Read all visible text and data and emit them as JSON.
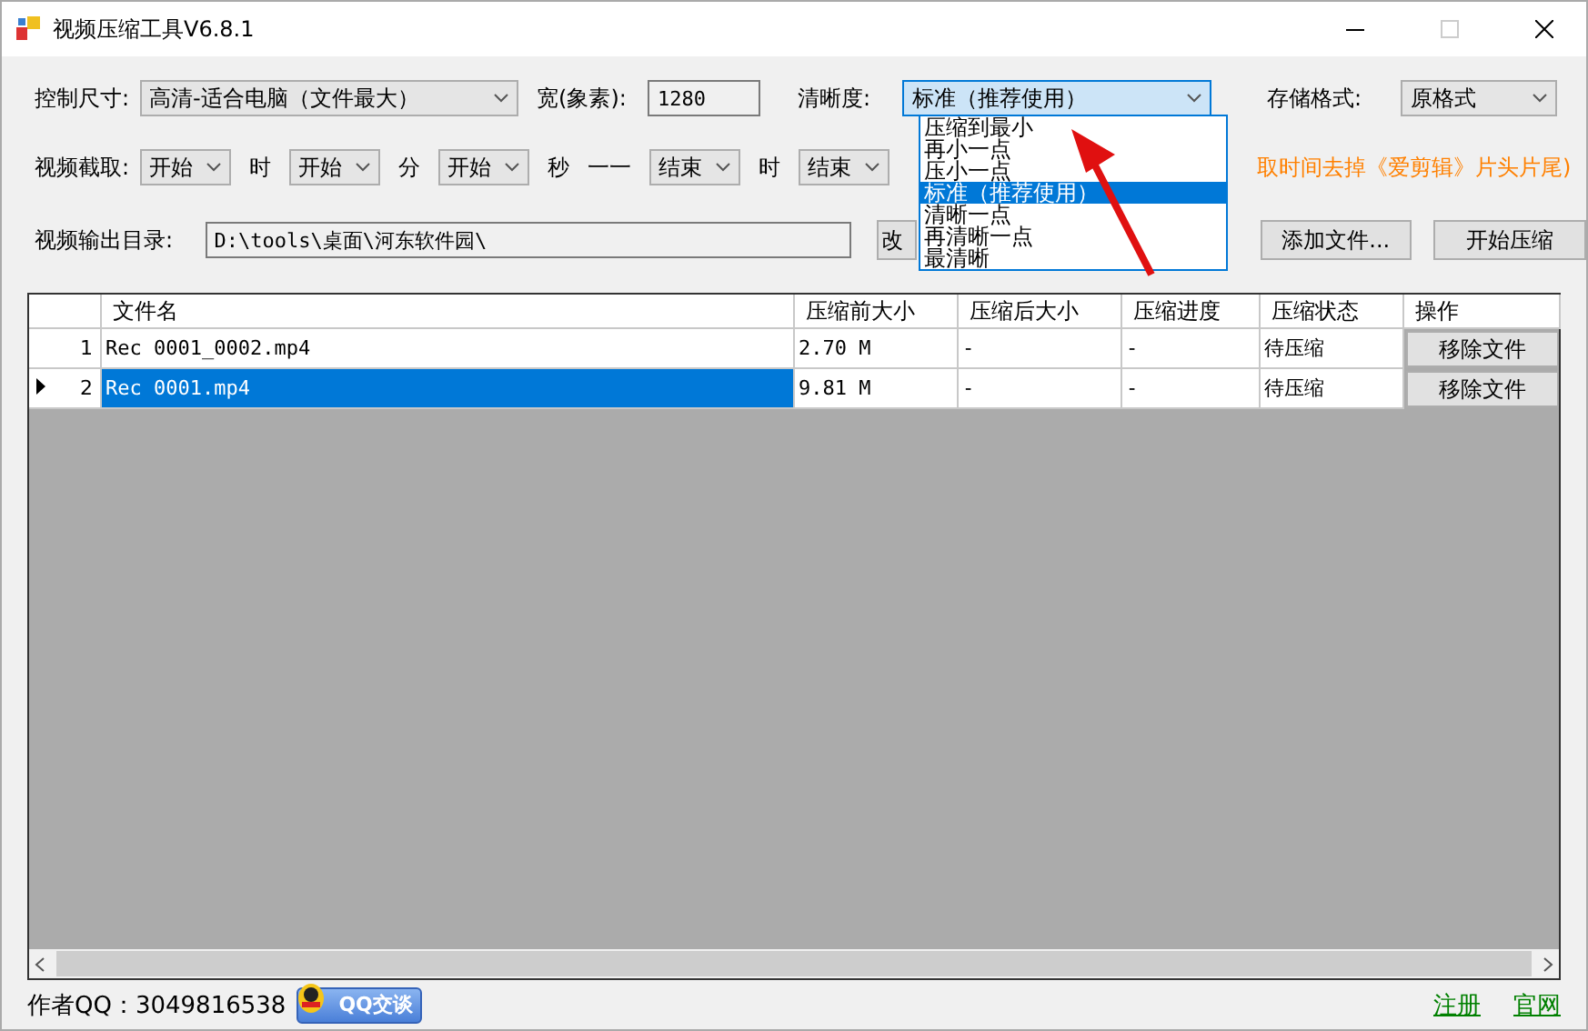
{
  "window": {
    "title": "视频压缩工具V6.8.1"
  },
  "size_row": {
    "label": "控制尺寸:",
    "size_value": "高清-适合电脑（文件最大）",
    "width_label": "宽(象素):",
    "width_value": "1280",
    "clarity_label": "清晰度:",
    "clarity_value": "标准（推荐使用）",
    "format_label": "存储格式:",
    "format_value": "原格式"
  },
  "clarity_dropdown": {
    "options": [
      {
        "label": "压缩到最小",
        "selected": false
      },
      {
        "label": "再小一点",
        "selected": false
      },
      {
        "label": "压小一点",
        "selected": false
      },
      {
        "label": "标准（推荐使用）",
        "selected": true
      },
      {
        "label": "清晰一点",
        "selected": false
      },
      {
        "label": "再清晰一点",
        "selected": false
      },
      {
        "label": "最清晰",
        "selected": false
      }
    ]
  },
  "trim_row": {
    "label": "视频截取:",
    "start_fields": [
      {
        "value": "开始",
        "unit": "时"
      },
      {
        "value": "开始",
        "unit": "分"
      },
      {
        "value": "开始",
        "unit": "秒"
      }
    ],
    "separator": "一一",
    "end_fields": [
      {
        "value": "结束",
        "unit": "时"
      },
      {
        "value": "结束"
      }
    ],
    "hint": "取时间去掉《爱剪辑》片头片尾)"
  },
  "output_row": {
    "label": "视频输出目录:",
    "path": "D:\\tools\\桌面\\河东软件园\\",
    "change_button": "改",
    "add_button": "添加文件...",
    "start_button": "开始压缩"
  },
  "table": {
    "columns": [
      "文件名",
      "压缩前大小",
      "压缩后大小",
      "压缩进度",
      "压缩状态",
      "操作"
    ],
    "rows": [
      {
        "index": "1",
        "selected": false,
        "cells": [
          "Rec 0001_0002.mp4",
          "2.70 M",
          "-",
          "-",
          "待压缩"
        ],
        "action": "移除文件"
      },
      {
        "index": "2",
        "selected": true,
        "cells": [
          "Rec 0001.mp4",
          "9.81 M",
          "-",
          "-",
          "待压缩"
        ],
        "action": "移除文件"
      }
    ]
  },
  "footer": {
    "author": "作者QQ：3049816538",
    "qq_button": "QQ交谈",
    "links": [
      "注册",
      "官网"
    ]
  }
}
